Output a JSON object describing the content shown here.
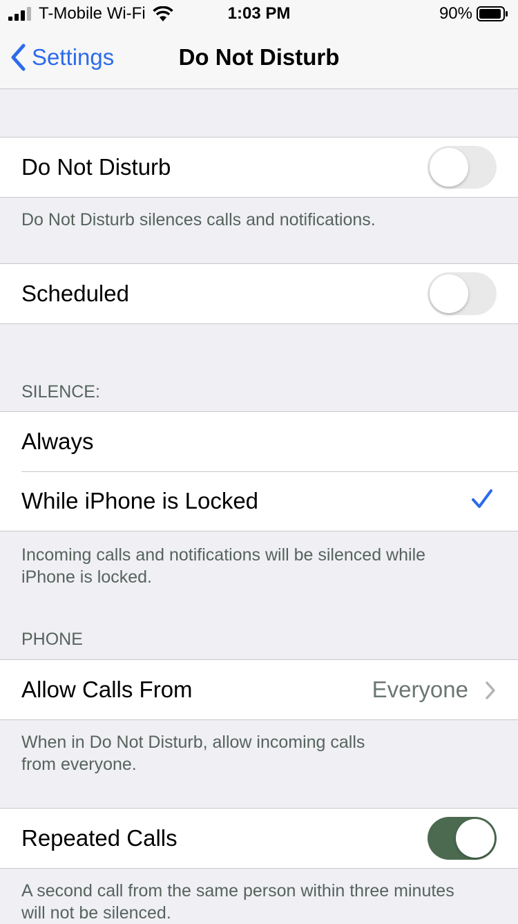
{
  "status_bar": {
    "carrier": "T-Mobile Wi-Fi",
    "time": "1:03 PM",
    "battery": "90%"
  },
  "nav": {
    "back_label": "Settings",
    "title": "Do Not Disturb"
  },
  "dnd": {
    "label": "Do Not Disturb",
    "on": false,
    "footer": "Do Not Disturb silences calls and notifications."
  },
  "scheduled": {
    "label": "Scheduled",
    "on": false
  },
  "silence": {
    "header": "SILENCE:",
    "options": [
      {
        "label": "Always",
        "selected": false
      },
      {
        "label": "While iPhone is Locked",
        "selected": true
      }
    ],
    "footer_line1": "Incoming calls and notifications will be silenced while",
    "footer_line2": "iPhone is locked."
  },
  "phone": {
    "header": "PHONE",
    "allow_calls": {
      "label": "Allow Calls From",
      "value": "Everyone"
    },
    "footer_line1": "When in Do Not Disturb, allow incoming calls",
    "footer_line2": "from everyone."
  },
  "repeated": {
    "label": "Repeated Calls",
    "on": true,
    "footer_line1": "A second call from the same person within three minutes",
    "footer_line2": "will not be silenced."
  },
  "colors": {
    "accent": "#2c6bea",
    "toggle_on": "#4b6a50",
    "toggle_off": "#e9e9ea",
    "background": "#efeff4"
  }
}
